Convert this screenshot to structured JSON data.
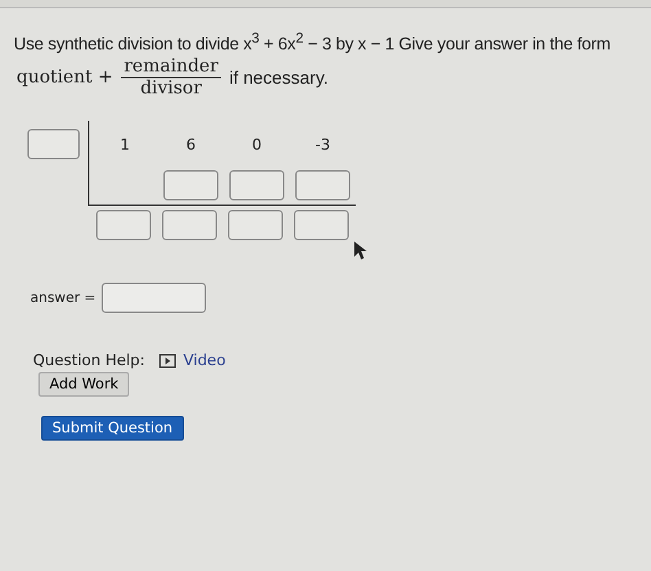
{
  "question": {
    "prompt": "Use synthetic division to divide x$^{3}$ + 6x$^{2}$ − 3 by x − 1 Give your answer in the form",
    "form": {
      "lead": "quotient +",
      "numerator": "remainder",
      "denominator": "divisor",
      "trail": "if necessary."
    }
  },
  "synthetic_division": {
    "coefficients": [
      "1",
      "6",
      "0",
      "-3"
    ]
  },
  "answer": {
    "label": "answer ="
  },
  "help": {
    "label": "Question Help:",
    "link": "Video",
    "button": "Add Work"
  },
  "submit": "Submit Question"
}
